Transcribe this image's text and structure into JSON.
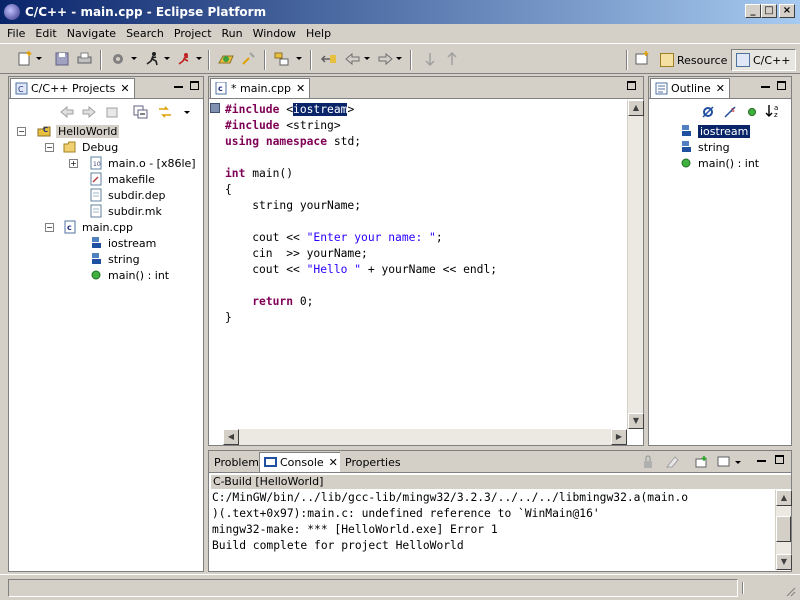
{
  "window": {
    "title": "C/C++ - main.cpp - Eclipse Platform"
  },
  "menu": [
    "File",
    "Edit",
    "Navigate",
    "Search",
    "Project",
    "Run",
    "Window",
    "Help"
  ],
  "perspectives": [
    {
      "label": "Resource",
      "active": false
    },
    {
      "label": "C/C++",
      "active": true
    }
  ],
  "projects": {
    "tab_label": "C/C++ Projects",
    "tree": [
      {
        "label": "HelloWorld",
        "level": 0,
        "icon": "project-icon",
        "expanded": true
      },
      {
        "label": "Debug",
        "level": 1,
        "icon": "folder-icon",
        "expanded": true
      },
      {
        "label": "main.o - [x86le]",
        "level": 2,
        "icon": "object-file-icon",
        "expandable": true
      },
      {
        "label": "makefile",
        "level": 2,
        "icon": "makefile-icon"
      },
      {
        "label": "subdir.dep",
        "level": 2,
        "icon": "file-icon"
      },
      {
        "label": "subdir.mk",
        "level": 2,
        "icon": "file-icon"
      },
      {
        "label": "main.cpp",
        "level": 1,
        "icon": "cpp-file-icon",
        "expanded": true
      },
      {
        "label": "iostream",
        "level": 2,
        "icon": "include-icon"
      },
      {
        "label": "string",
        "level": 2,
        "icon": "include-icon"
      },
      {
        "label": "main() : int",
        "level": 2,
        "icon": "function-icon"
      }
    ]
  },
  "editor": {
    "tab_label": "* main.cpp",
    "lines": [
      "#include <iostream>",
      "#include <string>",
      "using namespace std;",
      "",
      "int main()",
      "{",
      "    string yourName;",
      "",
      "    cout << \"Enter your name: \";",
      "    cin  >> yourName;",
      "    cout << \"Hello \" + yourName << endl;",
      "",
      "    return 0;",
      "}"
    ]
  },
  "outline": {
    "tab_label": "Outline",
    "items": [
      {
        "label": "iostream",
        "icon": "include-icon",
        "selected": true
      },
      {
        "label": "string",
        "icon": "include-icon"
      },
      {
        "label": "main() : int",
        "icon": "function-icon"
      }
    ]
  },
  "bottom": {
    "tabs": [
      "Problems",
      "Console",
      "Properties"
    ],
    "active_tab": "Console",
    "console_title": "C-Build [HelloWorld]",
    "console_lines": [
      "C:/MinGW/bin/../lib/gcc-lib/mingw32/3.2.3/../../../libmingw32.a(main.o",
      ")(.text+0x97):main.c: undefined reference to `WinMain@16'",
      "mingw32-make: *** [HelloWorld.exe] Error 1",
      "Build complete for project HelloWorld"
    ]
  },
  "colors": {
    "keyword": "#7f0055",
    "string": "#2a00ff",
    "selection": "#0a246a",
    "titlebar": "#0a246a"
  }
}
